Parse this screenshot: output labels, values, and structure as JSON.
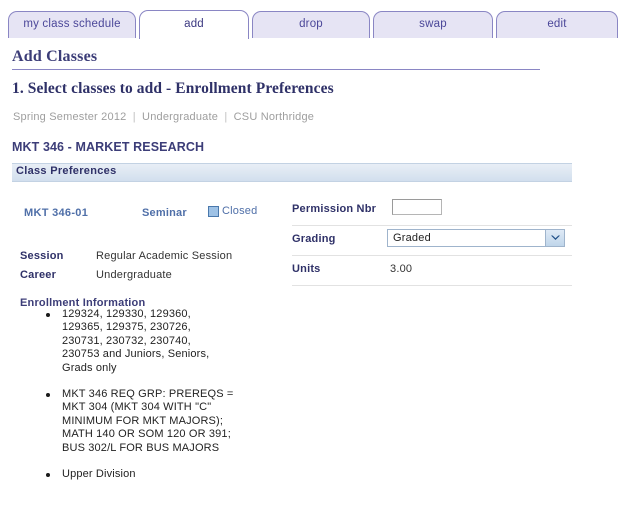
{
  "tabs": [
    {
      "label": "my class schedule",
      "active": false
    },
    {
      "label": "add",
      "active": true
    },
    {
      "label": "drop",
      "active": false
    },
    {
      "label": "swap",
      "active": false
    },
    {
      "label": "edit",
      "active": false
    }
  ],
  "header": {
    "page_title": "Add Classes",
    "step_title": "1.  Select classes to add - Enrollment Preferences",
    "breadcrumb": {
      "term": "Spring Semester 2012",
      "career": "Undergraduate",
      "institution": "CSU Northridge",
      "separator": "|"
    },
    "course_title": "MKT  346 - MARKET RESEARCH"
  },
  "section": {
    "title": "Class Preferences"
  },
  "class_row": {
    "section_link": "MKT  346-01",
    "component": "Seminar",
    "status_label": "Closed",
    "status_icon": "closed-square-icon"
  },
  "details": [
    {
      "label": "Session",
      "value": "Regular Academic Session"
    },
    {
      "label": "Career",
      "value": "Undergraduate"
    }
  ],
  "enrollment": {
    "heading": "Enrollment Information",
    "items": [
      "129324, 129330, 129360,\n129365, 129375, 230726,\n230731, 230732, 230740,\n230753 and Juniors, Seniors,\nGrads only",
      "MKT 346 REQ GRP: PREREQS =\nMKT 304 (MKT 304 WITH \"C\"\nMINIMUM FOR MKT MAJORS);\nMATH 140 OR SOM 120 OR 391;\nBUS 302/L FOR BUS MAJORS",
      "Upper Division"
    ]
  },
  "form": {
    "permission_nbr": {
      "label": "Permission Nbr",
      "value": "",
      "placeholder": ""
    },
    "grading": {
      "label": "Grading",
      "value": "Graded",
      "arrow_icon": "chevron-down-icon"
    },
    "units": {
      "label": "Units",
      "value": "3.00"
    }
  },
  "colors": {
    "tab_border": "#8a86c4",
    "tab_inactive_bg": "#e6e4f4",
    "tab_text": "#4b4799",
    "heading_navy": "#3c3d78",
    "section_bar_bg": "#dce6f1",
    "link_blue": "#4f6fa8",
    "status_box_fill": "#9ec2e6"
  }
}
